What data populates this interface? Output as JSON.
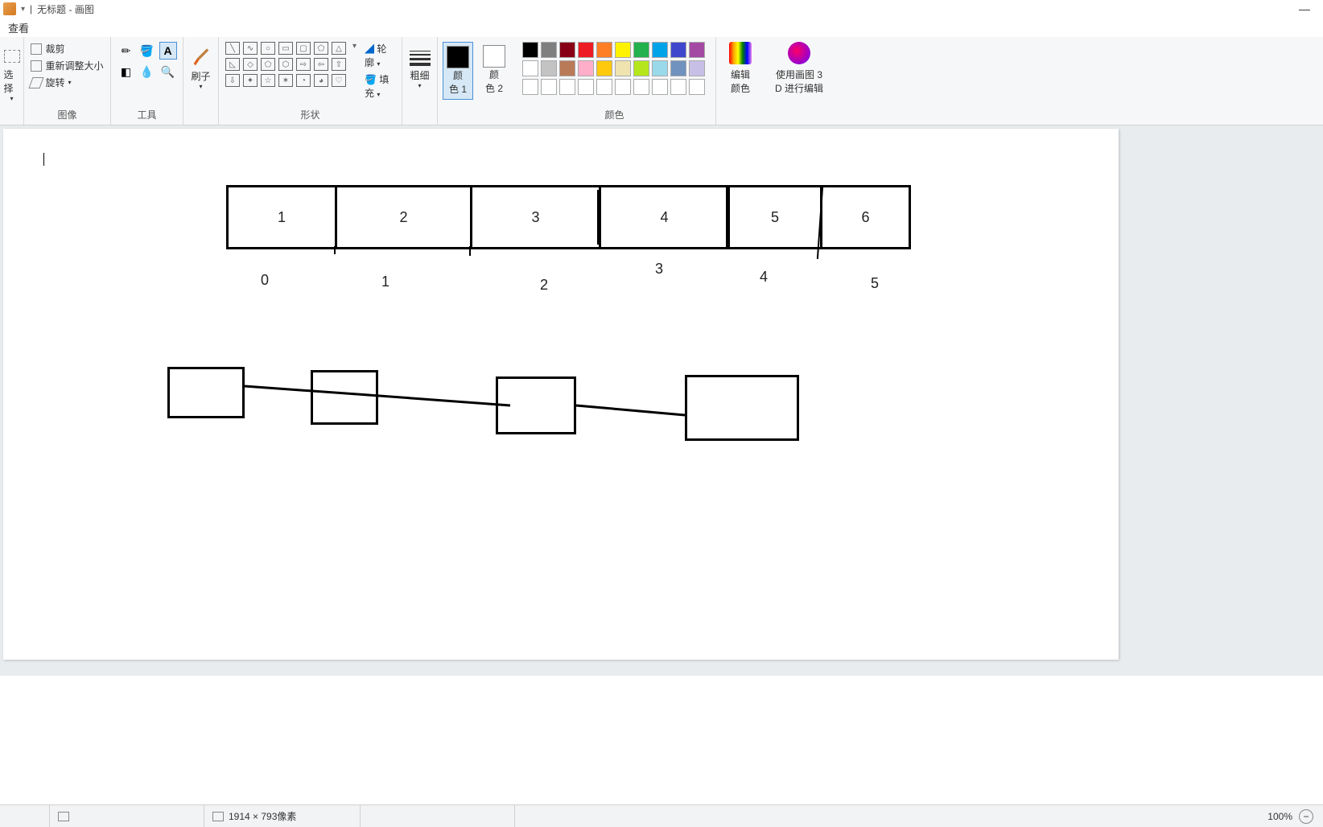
{
  "titlebar": {
    "title": "无标题 - 画图",
    "minimize": "—"
  },
  "menubar": {
    "view": "查看"
  },
  "ribbon": {
    "select": {
      "label": "选择",
      "group": ""
    },
    "image": {
      "crop": "裁剪",
      "resize": "重新调整大小",
      "rotate": "旋转",
      "group": "图像"
    },
    "tools": {
      "group": "工具"
    },
    "brush": {
      "label": "刷子"
    },
    "shapes": {
      "outline": "轮廓",
      "fill": "填充",
      "group": "形状"
    },
    "stroke": {
      "label": "粗细"
    },
    "color1": {
      "label1": "颜",
      "label2": "色 1"
    },
    "color2": {
      "label1": "颜",
      "label2": "色 2"
    },
    "colors": {
      "group": "颜色"
    },
    "editcolors": {
      "label1": "编辑",
      "label2": "颜色"
    },
    "paint3d": {
      "label1": "使用画图 3",
      "label2": "D 进行编辑"
    }
  },
  "canvas": {
    "cells": [
      "1",
      "2",
      "3",
      "4",
      "5",
      "6"
    ],
    "axis": [
      "0",
      "1",
      "2",
      "3",
      "4",
      "5"
    ]
  },
  "statusbar": {
    "size": "1914 × 793像素",
    "zoom": "100%"
  },
  "palette_row1": [
    "#000000",
    "#7f7f7f",
    "#880015",
    "#ed1c24",
    "#ff7f27",
    "#fff200",
    "#22b14c",
    "#00a2e8",
    "#3f48cc",
    "#a349a4"
  ],
  "palette_row2": [
    "#ffffff",
    "#c3c3c3",
    "#b97a57",
    "#ffaec9",
    "#ffc90e",
    "#efe4b0",
    "#b5e61d",
    "#99d9ea",
    "#7092be",
    "#c8bfe7"
  ]
}
